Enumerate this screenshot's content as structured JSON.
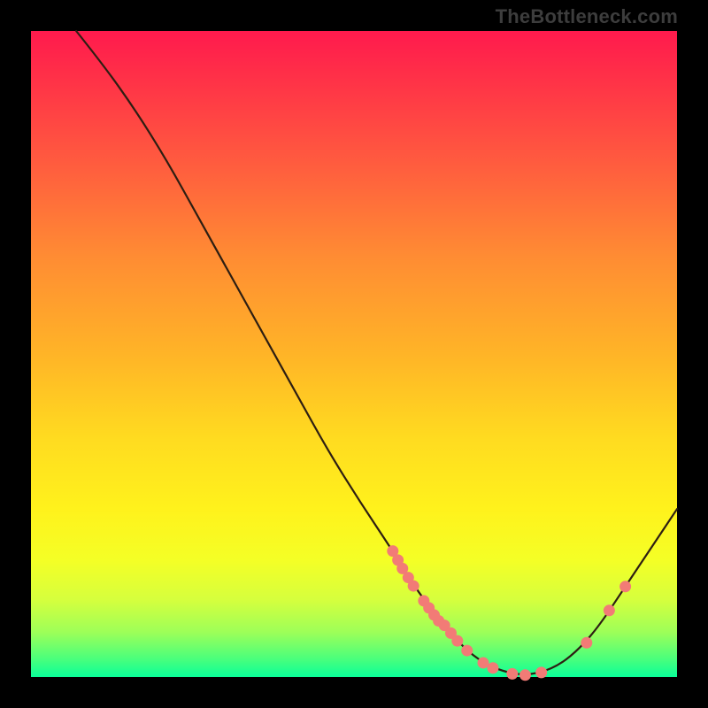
{
  "watermark": "TheBottleneck.com",
  "colors": {
    "background": "#000000",
    "curve_stroke": "#2d1e12",
    "marker_fill": "#f27b76",
    "marker_stroke": "#d25c57"
  },
  "chart_data": {
    "type": "line",
    "title": "",
    "xlabel": "",
    "ylabel": "",
    "xlim": [
      0,
      100
    ],
    "ylim": [
      0,
      100
    ],
    "curve": [
      {
        "x": 7,
        "y": 100
      },
      {
        "x": 11,
        "y": 95
      },
      {
        "x": 16,
        "y": 88
      },
      {
        "x": 21,
        "y": 80
      },
      {
        "x": 26,
        "y": 71
      },
      {
        "x": 31,
        "y": 62
      },
      {
        "x": 36,
        "y": 53
      },
      {
        "x": 41,
        "y": 44
      },
      {
        "x": 46,
        "y": 35
      },
      {
        "x": 51,
        "y": 27
      },
      {
        "x": 56,
        "y": 19.5
      },
      {
        "x": 60,
        "y": 13
      },
      {
        "x": 64,
        "y": 8
      },
      {
        "x": 67,
        "y": 4.5
      },
      {
        "x": 70,
        "y": 2.2
      },
      {
        "x": 73,
        "y": 0.9
      },
      {
        "x": 76,
        "y": 0.3
      },
      {
        "x": 79,
        "y": 0.7
      },
      {
        "x": 82,
        "y": 2.0
      },
      {
        "x": 85,
        "y": 4.5
      },
      {
        "x": 88,
        "y": 8.0
      },
      {
        "x": 92,
        "y": 14.0
      },
      {
        "x": 96,
        "y": 20.0
      },
      {
        "x": 100,
        "y": 26.0
      }
    ],
    "markers": [
      {
        "x": 56.0,
        "y": 19.5
      },
      {
        "x": 56.8,
        "y": 18.1
      },
      {
        "x": 57.5,
        "y": 16.8
      },
      {
        "x": 58.4,
        "y": 15.4
      },
      {
        "x": 59.2,
        "y": 14.1
      },
      {
        "x": 60.8,
        "y": 11.8
      },
      {
        "x": 61.6,
        "y": 10.7
      },
      {
        "x": 62.4,
        "y": 9.6
      },
      {
        "x": 63.1,
        "y": 8.7
      },
      {
        "x": 64.0,
        "y": 8.0
      },
      {
        "x": 65.0,
        "y": 6.8
      },
      {
        "x": 66.0,
        "y": 5.6
      },
      {
        "x": 67.5,
        "y": 4.1
      },
      {
        "x": 70.0,
        "y": 2.2
      },
      {
        "x": 71.5,
        "y": 1.4
      },
      {
        "x": 74.5,
        "y": 0.5
      },
      {
        "x": 76.5,
        "y": 0.3
      },
      {
        "x": 79.0,
        "y": 0.7
      },
      {
        "x": 86.0,
        "y": 5.3
      },
      {
        "x": 89.5,
        "y": 10.3
      },
      {
        "x": 92.0,
        "y": 14.0
      }
    ]
  }
}
